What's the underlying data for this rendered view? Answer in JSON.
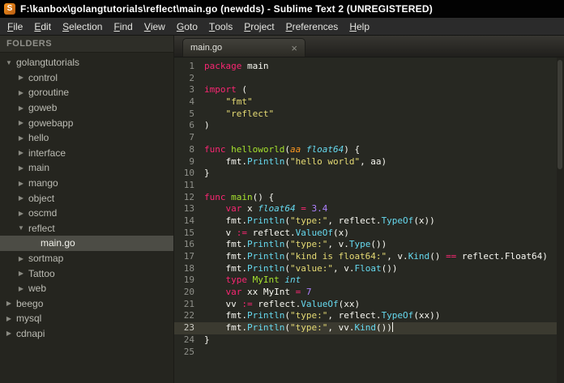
{
  "window": {
    "title": "F:\\kanbox\\golangtutorials\\reflect\\main.go (newdds) - Sublime Text 2 (UNREGISTERED)"
  },
  "icons": {
    "app_icon": "S",
    "folder_expanded": "▼",
    "folder_collapsed": "▶",
    "tab_close": "×"
  },
  "menu": {
    "items": [
      "File",
      "Edit",
      "Selection",
      "Find",
      "View",
      "Goto",
      "Tools",
      "Project",
      "Preferences",
      "Help"
    ]
  },
  "sidebar": {
    "header": "FOLDERS",
    "tree": [
      {
        "label": "golangtutorials",
        "level": 0,
        "kind": "folder",
        "expanded": true,
        "selected": false
      },
      {
        "label": "control",
        "level": 1,
        "kind": "folder",
        "expanded": false,
        "selected": false
      },
      {
        "label": "goroutine",
        "level": 1,
        "kind": "folder",
        "expanded": false,
        "selected": false
      },
      {
        "label": "goweb",
        "level": 1,
        "kind": "folder",
        "expanded": false,
        "selected": false
      },
      {
        "label": "gowebapp",
        "level": 1,
        "kind": "folder",
        "expanded": false,
        "selected": false
      },
      {
        "label": "hello",
        "level": 1,
        "kind": "folder",
        "expanded": false,
        "selected": false
      },
      {
        "label": "interface",
        "level": 1,
        "kind": "folder",
        "expanded": false,
        "selected": false
      },
      {
        "label": "main",
        "level": 1,
        "kind": "folder",
        "expanded": false,
        "selected": false
      },
      {
        "label": "mango",
        "level": 1,
        "kind": "folder",
        "expanded": false,
        "selected": false
      },
      {
        "label": "object",
        "level": 1,
        "kind": "folder",
        "expanded": false,
        "selected": false
      },
      {
        "label": "oscmd",
        "level": 1,
        "kind": "folder",
        "expanded": false,
        "selected": false
      },
      {
        "label": "reflect",
        "level": 1,
        "kind": "folder",
        "expanded": true,
        "selected": false
      },
      {
        "label": "main.go",
        "level": 2,
        "kind": "file",
        "expanded": false,
        "selected": true
      },
      {
        "label": "sortmap",
        "level": 1,
        "kind": "folder",
        "expanded": false,
        "selected": false
      },
      {
        "label": "Tattoo",
        "level": 1,
        "kind": "folder",
        "expanded": false,
        "selected": false
      },
      {
        "label": "web",
        "level": 1,
        "kind": "folder",
        "expanded": false,
        "selected": false
      },
      {
        "label": "beego",
        "level": 0,
        "kind": "folder",
        "expanded": false,
        "selected": false
      },
      {
        "label": "mysql",
        "level": 0,
        "kind": "folder",
        "expanded": false,
        "selected": false
      },
      {
        "label": "cdnapi",
        "level": 0,
        "kind": "folder",
        "expanded": false,
        "selected": false
      }
    ]
  },
  "tabs": [
    {
      "label": "main.go",
      "active": true
    }
  ],
  "editor": {
    "language": "go",
    "current_line": 23,
    "lines": [
      {
        "num": 1,
        "segs": [
          [
            "package",
            "keyword"
          ],
          [
            " main",
            "plain"
          ]
        ]
      },
      {
        "num": 2,
        "segs": []
      },
      {
        "num": 3,
        "segs": [
          [
            "import",
            "keyword"
          ],
          [
            " (",
            "plain"
          ]
        ]
      },
      {
        "num": 4,
        "segs": [
          [
            "    ",
            "plain"
          ],
          [
            "\"fmt\"",
            "string"
          ]
        ]
      },
      {
        "num": 5,
        "segs": [
          [
            "    ",
            "plain"
          ],
          [
            "\"reflect\"",
            "string"
          ]
        ]
      },
      {
        "num": 6,
        "segs": [
          [
            ")",
            "plain"
          ]
        ]
      },
      {
        "num": 7,
        "segs": []
      },
      {
        "num": 8,
        "segs": [
          [
            "func",
            "keyword"
          ],
          [
            " ",
            "plain"
          ],
          [
            "helloworld",
            "fname"
          ],
          [
            "(",
            "plain"
          ],
          [
            "aa",
            "param"
          ],
          [
            " ",
            "plain"
          ],
          [
            "float64",
            "type"
          ],
          [
            ") {",
            "plain"
          ]
        ]
      },
      {
        "num": 9,
        "segs": [
          [
            "    fmt.",
            "plain"
          ],
          [
            "Println",
            "func"
          ],
          [
            "(",
            "plain"
          ],
          [
            "\"hello world\"",
            "string"
          ],
          [
            ", aa)",
            "plain"
          ]
        ]
      },
      {
        "num": 10,
        "segs": [
          [
            "}",
            "plain"
          ]
        ]
      },
      {
        "num": 11,
        "segs": []
      },
      {
        "num": 12,
        "segs": [
          [
            "func",
            "keyword"
          ],
          [
            " ",
            "plain"
          ],
          [
            "main",
            "fname"
          ],
          [
            "() {",
            "plain"
          ]
        ]
      },
      {
        "num": 13,
        "segs": [
          [
            "    ",
            "plain"
          ],
          [
            "var",
            "keyword"
          ],
          [
            " x ",
            "plain"
          ],
          [
            "float64",
            "type"
          ],
          [
            " ",
            "plain"
          ],
          [
            "=",
            "keyword"
          ],
          [
            " ",
            "plain"
          ],
          [
            "3.4",
            "number"
          ]
        ]
      },
      {
        "num": 14,
        "segs": [
          [
            "    fmt.",
            "plain"
          ],
          [
            "Println",
            "func"
          ],
          [
            "(",
            "plain"
          ],
          [
            "\"type:\"",
            "string"
          ],
          [
            ", reflect.",
            "plain"
          ],
          [
            "TypeOf",
            "func"
          ],
          [
            "(x))",
            "plain"
          ]
        ]
      },
      {
        "num": 15,
        "segs": [
          [
            "    v ",
            "plain"
          ],
          [
            ":=",
            "keyword"
          ],
          [
            " reflect.",
            "plain"
          ],
          [
            "ValueOf",
            "func"
          ],
          [
            "(x)",
            "plain"
          ]
        ]
      },
      {
        "num": 16,
        "segs": [
          [
            "    fmt.",
            "plain"
          ],
          [
            "Println",
            "func"
          ],
          [
            "(",
            "plain"
          ],
          [
            "\"type:\"",
            "string"
          ],
          [
            ", v.",
            "plain"
          ],
          [
            "Type",
            "func"
          ],
          [
            "())",
            "plain"
          ]
        ]
      },
      {
        "num": 17,
        "segs": [
          [
            "    fmt.",
            "plain"
          ],
          [
            "Println",
            "func"
          ],
          [
            "(",
            "plain"
          ],
          [
            "\"kind is float64:\"",
            "string"
          ],
          [
            ", v.",
            "plain"
          ],
          [
            "Kind",
            "func"
          ],
          [
            "() ",
            "plain"
          ],
          [
            "==",
            "keyword"
          ],
          [
            " reflect.Float64)",
            "plain"
          ]
        ]
      },
      {
        "num": 18,
        "segs": [
          [
            "    fmt.",
            "plain"
          ],
          [
            "Println",
            "func"
          ],
          [
            "(",
            "plain"
          ],
          [
            "\"value:\"",
            "string"
          ],
          [
            ", v.",
            "plain"
          ],
          [
            "Float",
            "func"
          ],
          [
            "())",
            "plain"
          ]
        ]
      },
      {
        "num": 19,
        "segs": [
          [
            "    ",
            "plain"
          ],
          [
            "type",
            "keyword"
          ],
          [
            " ",
            "plain"
          ],
          [
            "MyInt",
            "fname"
          ],
          [
            " ",
            "plain"
          ],
          [
            "int",
            "type"
          ]
        ]
      },
      {
        "num": 20,
        "segs": [
          [
            "    ",
            "plain"
          ],
          [
            "var",
            "keyword"
          ],
          [
            " xx MyInt ",
            "plain"
          ],
          [
            "=",
            "keyword"
          ],
          [
            " ",
            "plain"
          ],
          [
            "7",
            "number"
          ]
        ]
      },
      {
        "num": 21,
        "segs": [
          [
            "    vv ",
            "plain"
          ],
          [
            ":=",
            "keyword"
          ],
          [
            " reflect.",
            "plain"
          ],
          [
            "ValueOf",
            "func"
          ],
          [
            "(xx)",
            "plain"
          ]
        ]
      },
      {
        "num": 22,
        "segs": [
          [
            "    fmt.",
            "plain"
          ],
          [
            "Println",
            "func"
          ],
          [
            "(",
            "plain"
          ],
          [
            "\"type:\"",
            "string"
          ],
          [
            ", reflect.",
            "plain"
          ],
          [
            "TypeOf",
            "func"
          ],
          [
            "(xx))",
            "plain"
          ]
        ]
      },
      {
        "num": 23,
        "segs": [
          [
            "    fmt.",
            "plain"
          ],
          [
            "Println",
            "func"
          ],
          [
            "(",
            "plain"
          ],
          [
            "\"type:\"",
            "string"
          ],
          [
            ", vv.",
            "plain"
          ],
          [
            "Kind",
            "func"
          ],
          [
            "())",
            "plain"
          ]
        ]
      },
      {
        "num": 24,
        "segs": [
          [
            "}",
            "plain"
          ]
        ]
      },
      {
        "num": 25,
        "segs": []
      }
    ]
  },
  "colors": {
    "editor_bg": "#272822",
    "line_highlight": "#3b3a30",
    "keyword": "#f92672",
    "string": "#e6db74",
    "function_call": "#66d9ef",
    "function_name": "#a6e22e",
    "storage_type": "#66d9ef",
    "number": "#ae81ff",
    "parameter": "#fd971f",
    "plain_text": "#f8f8f2",
    "line_number": "#8f908a",
    "sidebar_bg": "#25251f",
    "selection_row": "#4c4c45",
    "titlebar_bg": "#020202"
  }
}
